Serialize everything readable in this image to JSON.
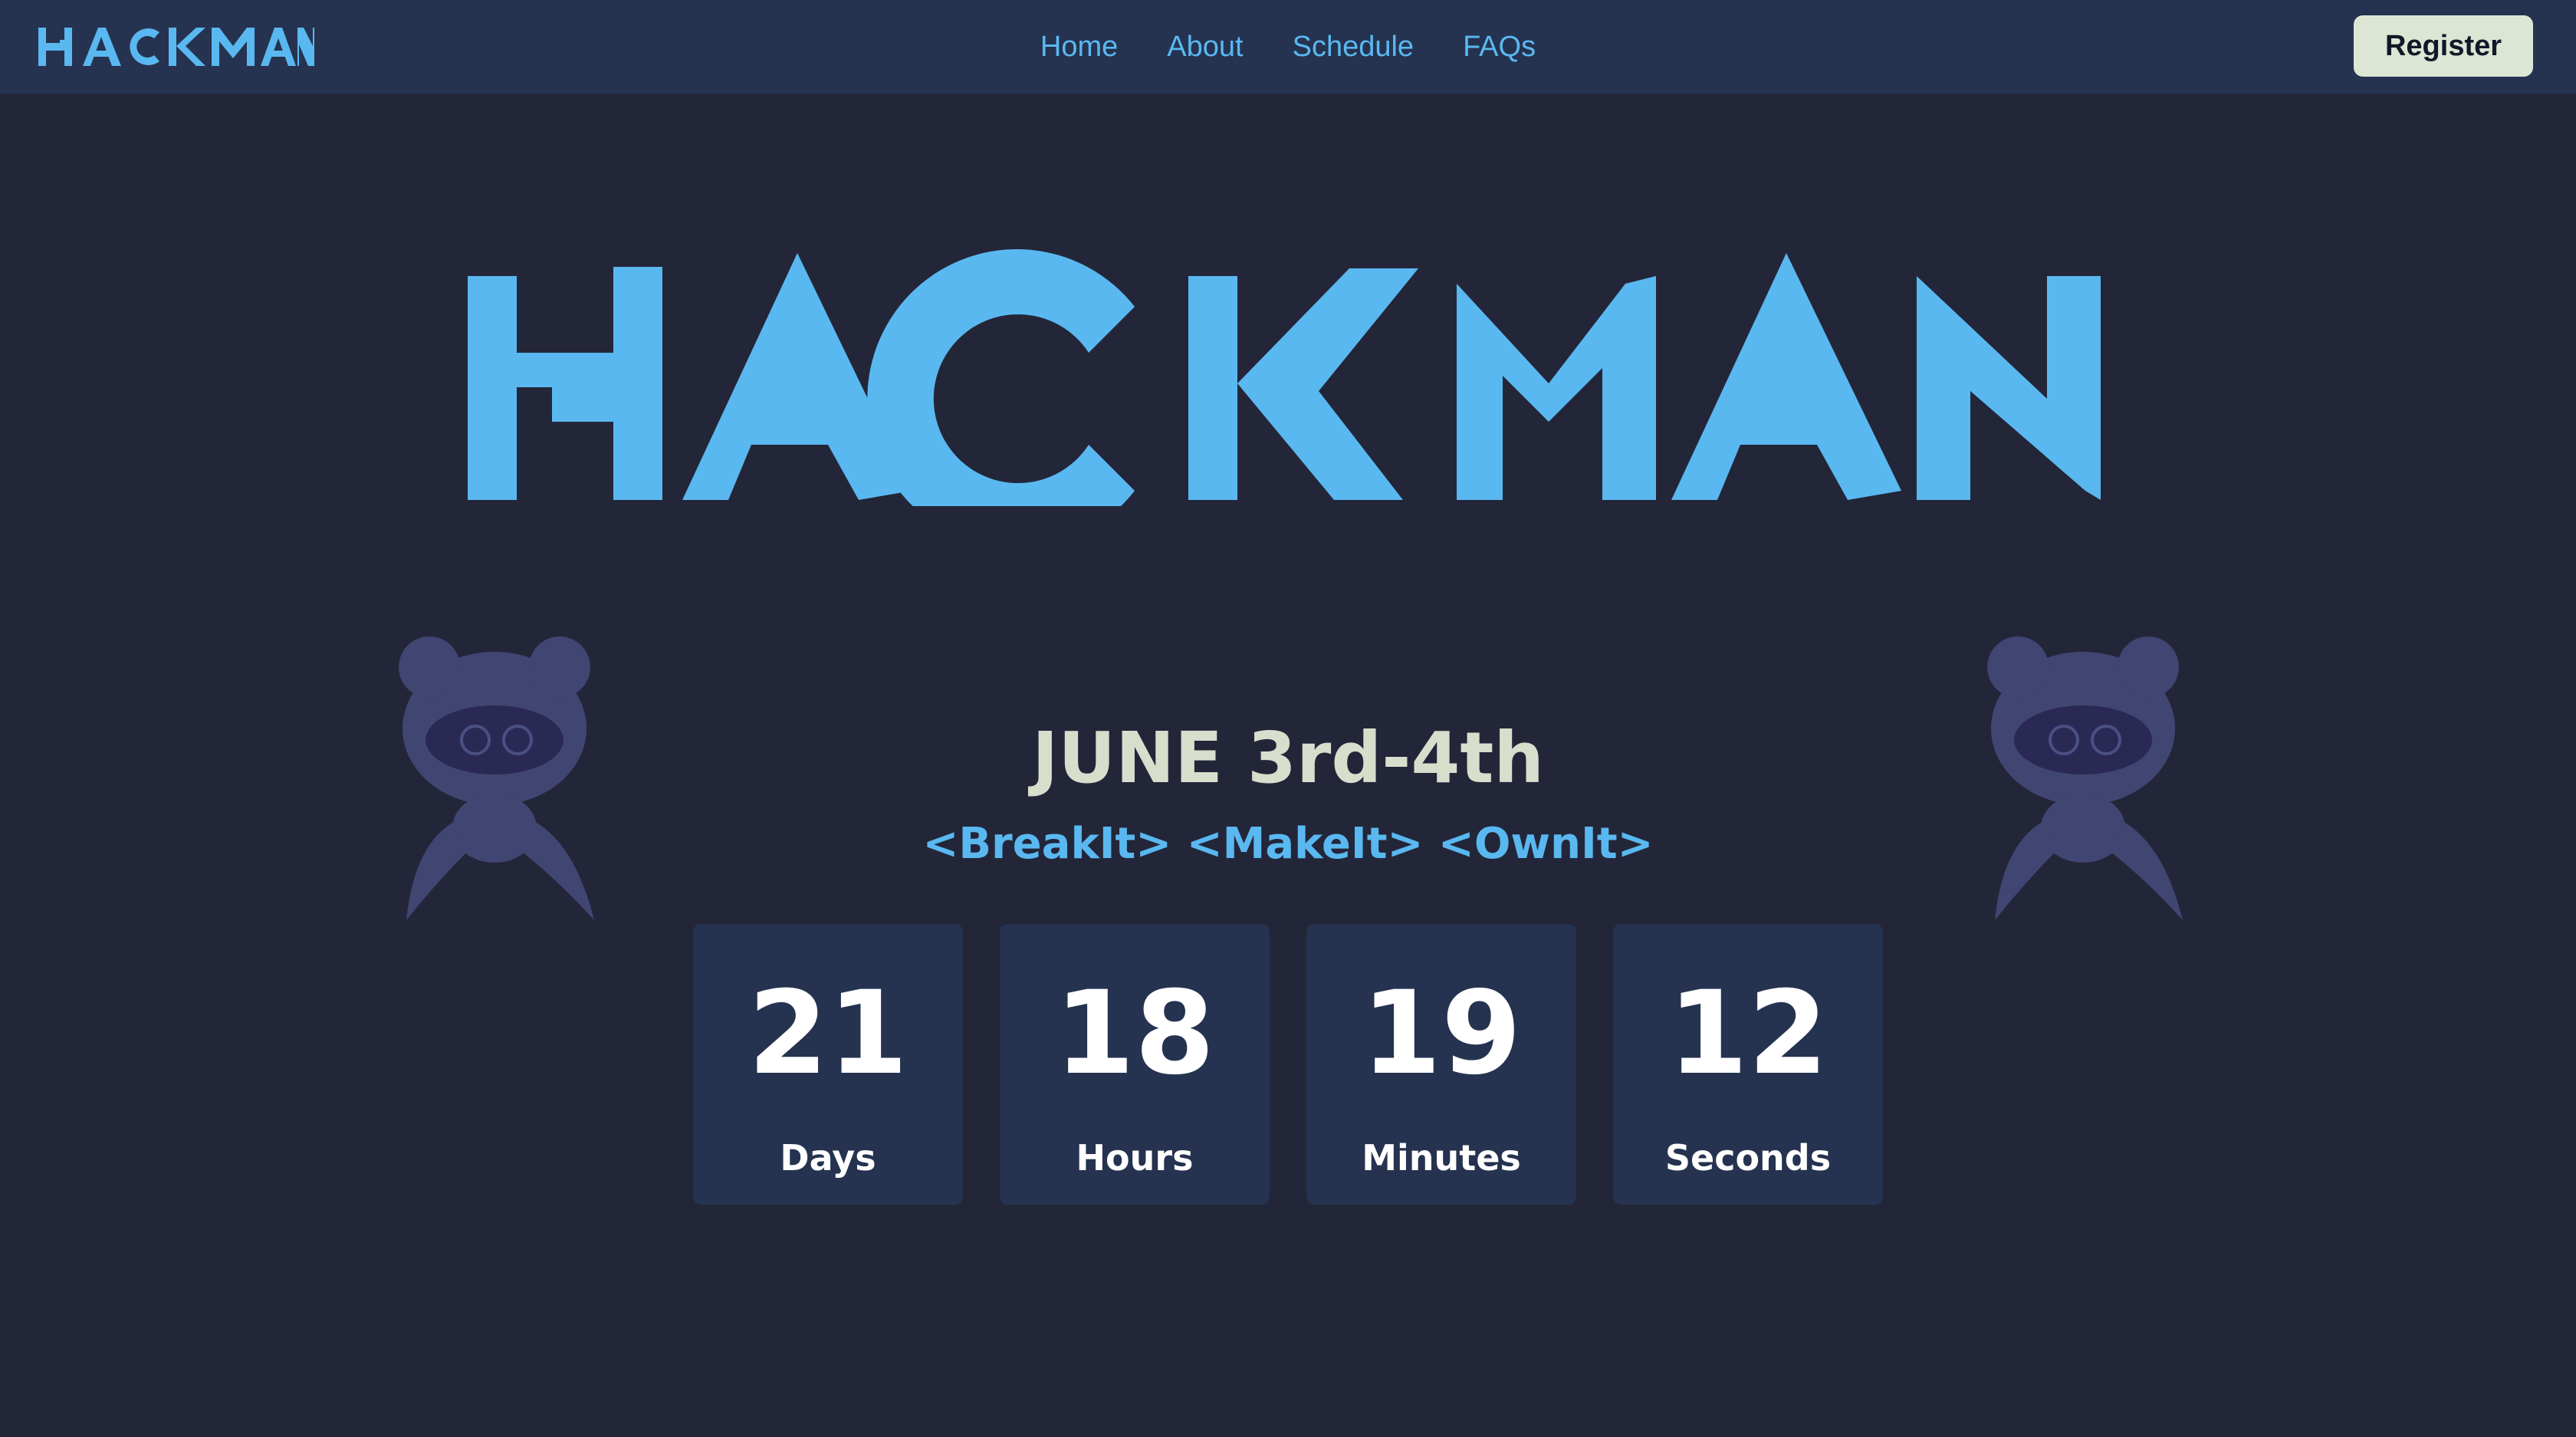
{
  "header": {
    "brand_text": "HACKMAN",
    "nav": [
      {
        "label": "Home"
      },
      {
        "label": "About"
      },
      {
        "label": "Schedule"
      },
      {
        "label": "FAQs"
      }
    ],
    "register_label": "Register"
  },
  "hero": {
    "logo_text": "HACKMAN",
    "date": "JUNE 3rd-4th",
    "tagline": "<BreakIt> <MakeIt> <OwnIt>",
    "mascot_icon": "robot-mascot-icon"
  },
  "countdown": [
    {
      "value": "21",
      "unit": "Days"
    },
    {
      "value": "18",
      "unit": "Hours"
    },
    {
      "value": "19",
      "unit": "Minutes"
    },
    {
      "value": "12",
      "unit": "Seconds"
    }
  ],
  "colors": {
    "background": "#232639",
    "header_bg": "#253350",
    "accent": "#5ab8f0",
    "date_text": "#d9ddcc",
    "register_bg": "#dde5d5"
  }
}
